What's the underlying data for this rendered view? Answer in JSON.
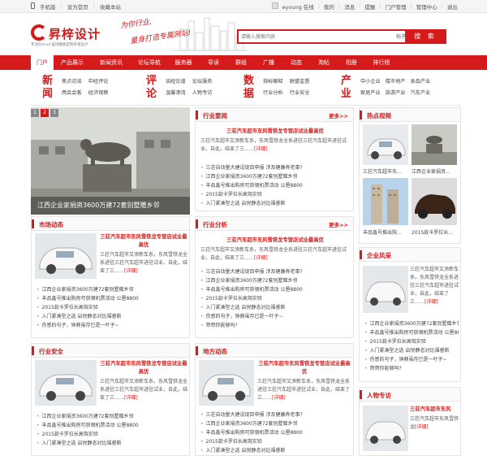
{
  "topbar": {
    "left": [
      "手机版",
      "设为首页",
      "收藏本站"
    ],
    "right": [
      "eyoung 在线",
      "我的",
      "消息",
      "提醒",
      "门户管理",
      "管理中心",
      "退出"
    ]
  },
  "header": {
    "logo_name": "昇梓设计",
    "logo_sub": "专注Discuz!蓝绿模板定制开发设计",
    "slogan1": "为你行业,",
    "slogan2": "量身打造专属网站!",
    "search_placeholder": "请输入搜索内容",
    "search_type": "帖子",
    "search_button": "搜 索"
  },
  "nav": [
    "门户",
    "产品展示",
    "新闻资讯",
    "论坛导航",
    "服务器",
    "导读",
    "群组",
    "广播",
    "动态",
    "淘帖",
    "相册",
    "排行榜"
  ],
  "subnav": [
    {
      "big": "新闻",
      "links": [
        "焦点访谈",
        "中经评论",
        "两会会客",
        "经济观察"
      ]
    },
    {
      "big": "评论",
      "links": [
        "谈经论道",
        "论坛服务",
        "温馨港湾",
        "人物专访"
      ]
    },
    {
      "big": "数据",
      "links": [
        "指标解释",
        "联盟监督",
        "行业分析",
        "行业安全"
      ]
    },
    {
      "big": "产业",
      "links": [
        "中小企业",
        "楼市地产",
        "食品产业",
        "家居产业",
        "旅游产业",
        "汽车产业"
      ]
    }
  ],
  "slide": {
    "pages": [
      "1",
      "2",
      "3"
    ],
    "caption": "江西企业家捐资3600万建72套别墅赠乡邻"
  },
  "sections": {
    "industry_news": {
      "title": "行业要闻",
      "more": "更多>>",
      "headline": "三荘汽车超市东风雪铁龙专营店试业最高优",
      "para": "三荘汽车超市又添新车系，东风雪铁龙全系进驻三荘汽车超市进驻试业，自此，结束了三……",
      "detail": "[详细]",
      "items": [
        "三荘自动量大建设现目申报 涉及健康养老事?",
        "江西企业家捐资3600万建72套别墅赠乡邻",
        "丰品鑫号推出购房可获钢机票活动 公厘8800",
        "2015款卡罗拉长高驾实验",
        "入门紧凑型之选 启悦静态对比福睿斯"
      ]
    },
    "hot_video": {
      "title": "热点视频",
      "videos": [
        "三荘汽车超市东...",
        "江西企业家捐资...",
        "丰品鑫号推出购...",
        "2015款卡罗拉长..."
      ]
    },
    "market": {
      "title": "市场动态",
      "headline": "三荘汽车超市东风雪铁龙专营店试业最高优",
      "para": "三荘汽车超市又添新车系，东风雪铁龙全系进驻三荘汽车超市进驻试业，自此，结束了三……",
      "detail": "[详细]",
      "items": [
        "江西企业家捐资3600万建72套别墅赠乡邻",
        "丰品鑫号推出购房可获钢机票活动 公厘8800",
        "2015款卡罗拉长高驾实验",
        "入门紧凑型之选 启悦静态对比福睿斯",
        "伤感的句子，钟鼎虽存已是一叶子~"
      ]
    },
    "analysis": {
      "title": "行业分析",
      "more": "更多>>",
      "headline": "三荘汽车超市东风雪铁龙专营店试业最高优",
      "para": "三荘汽车超市又添新车系，东风雪铁龙全系进驻三荘汽车超市进驻试业，自此，结束了三……",
      "detail": "[详细]",
      "items": [
        "三荘自动量大建设现目申报 涉及健康养老事?",
        "江西企业家捐资3600万建72套别墅赠乡邻",
        "丰品鑫号推出购房可获钢机票活动 公厘8800",
        "2015款卡罗拉长高驾实验",
        "入门紧凑型之选 启悦静态对比福睿斯",
        "伤感的句子，钟鼎虽存已是一叶子~",
        "哥哥你能够吗?"
      ]
    },
    "enterprise": {
      "title": "企业风采",
      "para": "三荘汽车超市又添新车系，东风雪铁龙全系进驻三荘汽车超市进驻试业，自此，结束了三……",
      "detail": "[详细]",
      "items": [
        "江西企业家捐资3600万建72套别墅赠乡邻",
        "丰品鑫号推出购房可获钢机票活动 公厘8800",
        "2015款卡罗拉长高驾实验",
        "入门紧凑型之选 启悦静态对比福睿斯",
        "伤感的句子，钟鼎虽存已是一叶子~",
        "哥哥你能够吗?"
      ]
    },
    "safety": {
      "title": "行业安全",
      "headline": "三荘汽车超市东风雪铁龙专营店试业最高优",
      "para": "三荘汽车超市又添新车系，东风雪铁龙全系进驻三荘汽车超市进驻试业，自此，结束了三……",
      "detail": "[详细]",
      "items": [
        "江西企业家捐资3600万建72套别墅赠乡邻",
        "丰品鑫号推出购房可获钢机票活动 公厘8800",
        "2015款卡罗拉长高驾实验",
        "入门紧凑型之选 启悦静态对比福睿斯"
      ]
    },
    "local": {
      "title": "地方动态",
      "headline": "三荘汽车超市东风雪铁龙专营店试业最高优",
      "para": "三荘汽车超市又添新车系，东风雪铁龙全系进驻三荘汽车超市进驻试业，自此，结束了三……",
      "detail": "[详细]",
      "items": [
        "三荘自动量大建设现目申报 涉及健康养老事?",
        "江西企业家捐资3600万建72套别墅赠乡邻",
        "丰品鑫号推出购房可获钢机票活动 公厘8800",
        "2015款卡罗拉长高驾实验",
        "入门紧凑型之选 启悦静态对比福睿斯"
      ]
    },
    "people": {
      "title": "人物专访",
      "headline": "三荘汽车超市东风",
      "para": "三荘汽车超市东风雪铁龙",
      "detail": "[详细]"
    }
  },
  "colors": {
    "accent": "#d41a1a"
  }
}
